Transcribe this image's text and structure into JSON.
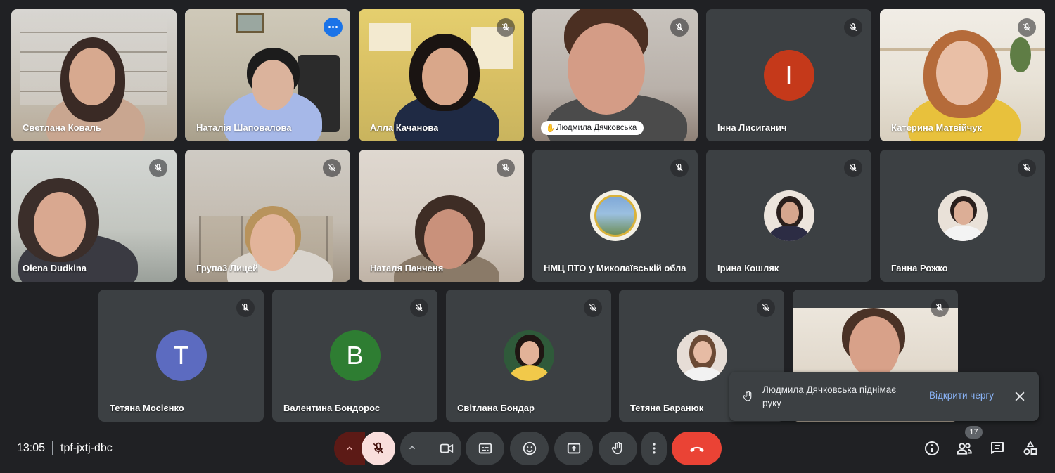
{
  "participants": [
    {
      "name": "Светлана Коваль"
    },
    {
      "name": "Наталія Шаповалова"
    },
    {
      "name": "Алла Качанова"
    },
    {
      "name": "Людмила Дячковська"
    },
    {
      "name": "Інна Лисиганич",
      "avatar_letter": "I",
      "avatar_color": "#c5391a"
    },
    {
      "name": "Катерина Матвійчук"
    },
    {
      "name": "Olena Dudkina"
    },
    {
      "name": "Група3 Лицей"
    },
    {
      "name": "Наталя Панченя"
    },
    {
      "name": "НМЦ ПТО у Миколаївській обла"
    },
    {
      "name": "Ірина Кошляк"
    },
    {
      "name": "Ганна Рожко"
    },
    {
      "name": "Тетяна Мосієнко",
      "avatar_letter": "T",
      "avatar_color": "#5c6bc0"
    },
    {
      "name": "Валентина Бондорос",
      "avatar_letter": "B",
      "avatar_color": "#2e7d32"
    },
    {
      "name": "Світлана Бондар"
    },
    {
      "name": "Тетяна Баранюк"
    },
    {
      "name": ""
    }
  ],
  "toast": {
    "message": "Людмила Дячковська піднімає руку",
    "action": "Відкрити чергу",
    "icon": "hand-icon"
  },
  "meeting": {
    "time": "13:05",
    "code": "tpf-jxtj-dbc",
    "participant_count": "17"
  },
  "colors": {
    "background": "#202124",
    "tile": "#3c4043",
    "active_speaker": "#8ab4f8",
    "end_call": "#ea4335",
    "mic_off": "#f9dedc"
  }
}
